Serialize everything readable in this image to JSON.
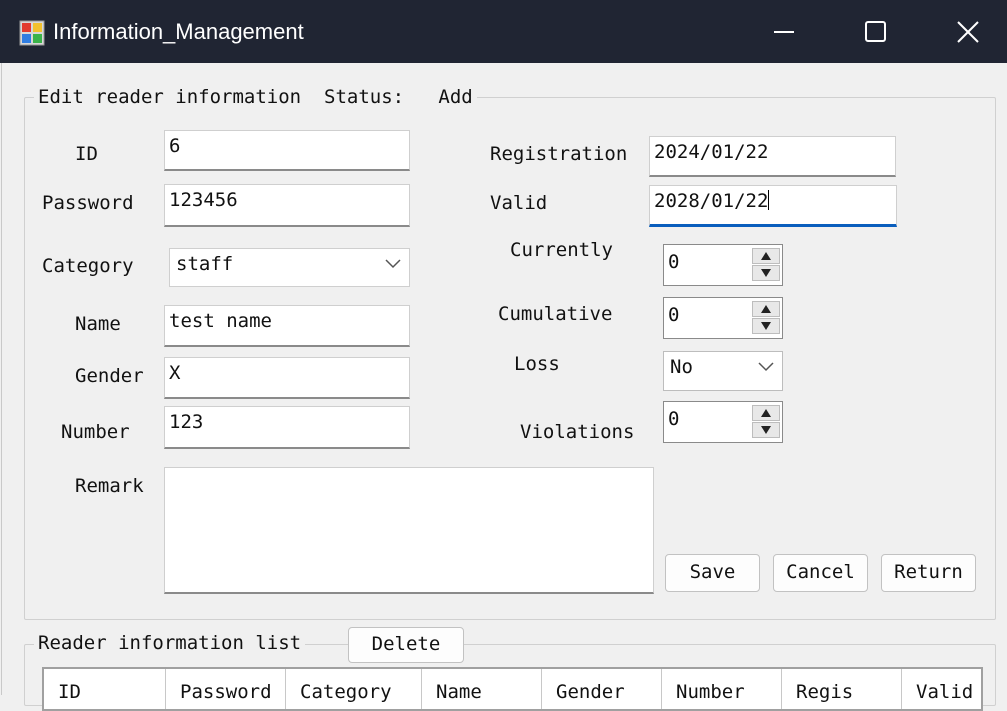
{
  "window": {
    "title": "Information_Management"
  },
  "edit_group": {
    "title": "Edit reader information",
    "status_label": "Status:",
    "status_value": "Add"
  },
  "fields": {
    "id": {
      "label": "ID",
      "value": "6"
    },
    "password": {
      "label": "Password",
      "value": "123456"
    },
    "category": {
      "label": "Category",
      "value": "staff"
    },
    "name": {
      "label": "Name",
      "value": "test name"
    },
    "gender": {
      "label": "Gender",
      "value": "X"
    },
    "number": {
      "label": "Number",
      "value": "123"
    },
    "remark": {
      "label": "Remark",
      "value": ""
    },
    "registration": {
      "label": "Registration",
      "value": "2024/01/22"
    },
    "valid": {
      "label": "Valid",
      "value": "2028/01/22"
    },
    "currently": {
      "label": "Currently",
      "value": "0"
    },
    "cumulative": {
      "label": "Cumulative",
      "value": "0"
    },
    "loss": {
      "label": "Loss",
      "value": "No"
    },
    "violations": {
      "label": "Violations",
      "value": "0"
    }
  },
  "buttons": {
    "save": "Save",
    "cancel": "Cancel",
    "return": "Return",
    "delete": "Delete"
  },
  "list_group": {
    "title": "Reader information list",
    "columns": [
      "ID",
      "Password",
      "Category",
      "Name",
      "Gender",
      "Number",
      "Regis",
      "Valid"
    ]
  },
  "colors": {
    "titlebar": "#202533",
    "focus_underline": "#0a5ebd"
  },
  "icons": {
    "app": "app-icon",
    "minimize": "minimize-icon",
    "maximize": "maximize-icon",
    "close": "close-icon"
  }
}
